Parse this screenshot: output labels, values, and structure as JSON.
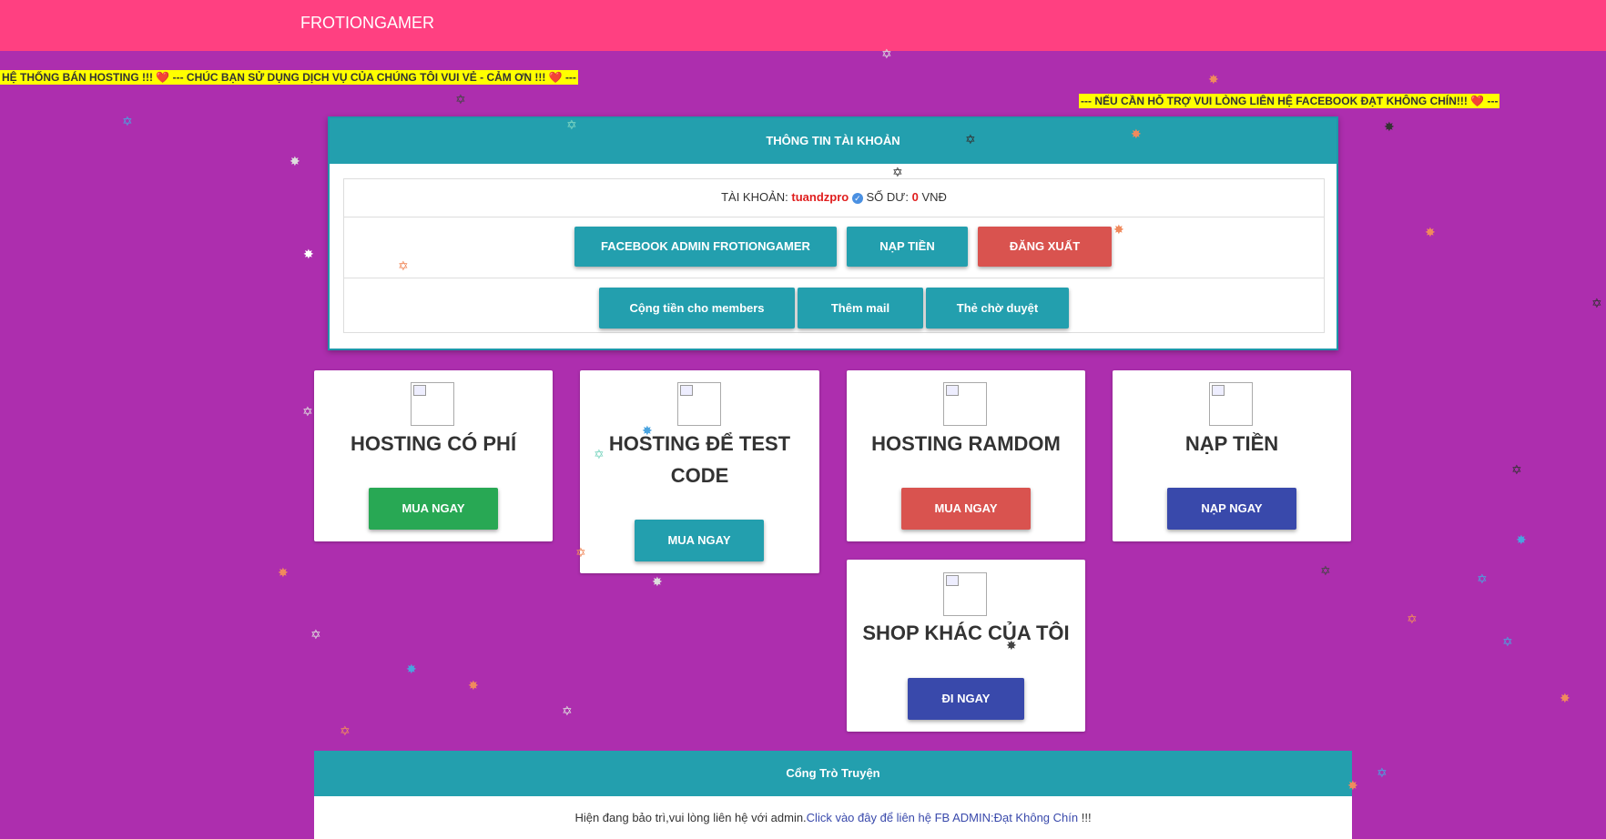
{
  "brand": "FROTIONGAMER",
  "marquee": {
    "left": "HỆ THỐNG BÁN HOSTING !!! ❤️ --- CHÚC BẠN SỬ DỤNG DỊCH VỤ CỦA CHÚNG TÔI VUI VẺ - CẢM ƠN !!! ❤️ ---",
    "right": "--- NẾU CẦN HỖ TRỢ VUI LÒNG LIÊN HỆ FACEBOOK ĐẠT KHÔNG CHÍN!!! ❤️ ---"
  },
  "account": {
    "heading": "THÔNG TIN TÀI KHOẢN",
    "account_label": "TÀI KHOẢN:",
    "username": "tuandzpro",
    "balance_label": "SỐ DƯ:",
    "balance": "0",
    "currency": "VNĐ",
    "buttons": {
      "facebook": "FACEBOOK ADMIN FROTIONGAMER",
      "topup": "NẠP TIỀN",
      "logout": "ĐĂNG XUẤT",
      "add_money": "Cộng tiền cho members",
      "add_mail": "Thêm mail",
      "pending_cards": "Thẻ chờ duyệt"
    }
  },
  "cards": [
    {
      "title": "HOSTING CÓ PHÍ",
      "button": "MUA NGAY"
    },
    {
      "title": "HOSTING ĐỂ TEST CODE",
      "button": "MUA NGAY"
    },
    {
      "title": "HOSTING RAMDOM",
      "button": "MUA NGAY"
    },
    {
      "title": "NẠP TIỀN",
      "button": "NẠP NGAY"
    },
    {
      "title": "SHOP KHÁC CỦA TÔI",
      "button": "ĐI NGAY"
    }
  ],
  "story": {
    "heading": "Cổng Trò Truyện",
    "text": "Hiện đang bảo trì,vui lòng liên hệ với admin.",
    "link": "Click vào đây để liên hệ FB ADMIN:Đạt Không Chín",
    "suffix": " !!!"
  },
  "colors": {
    "background": "#ad2eae",
    "topbar": "#ff4081",
    "teal": "#239fae",
    "red": "#d9534f",
    "green": "#28a854",
    "indigo": "#3949ab",
    "marquee": "#ffff00"
  }
}
